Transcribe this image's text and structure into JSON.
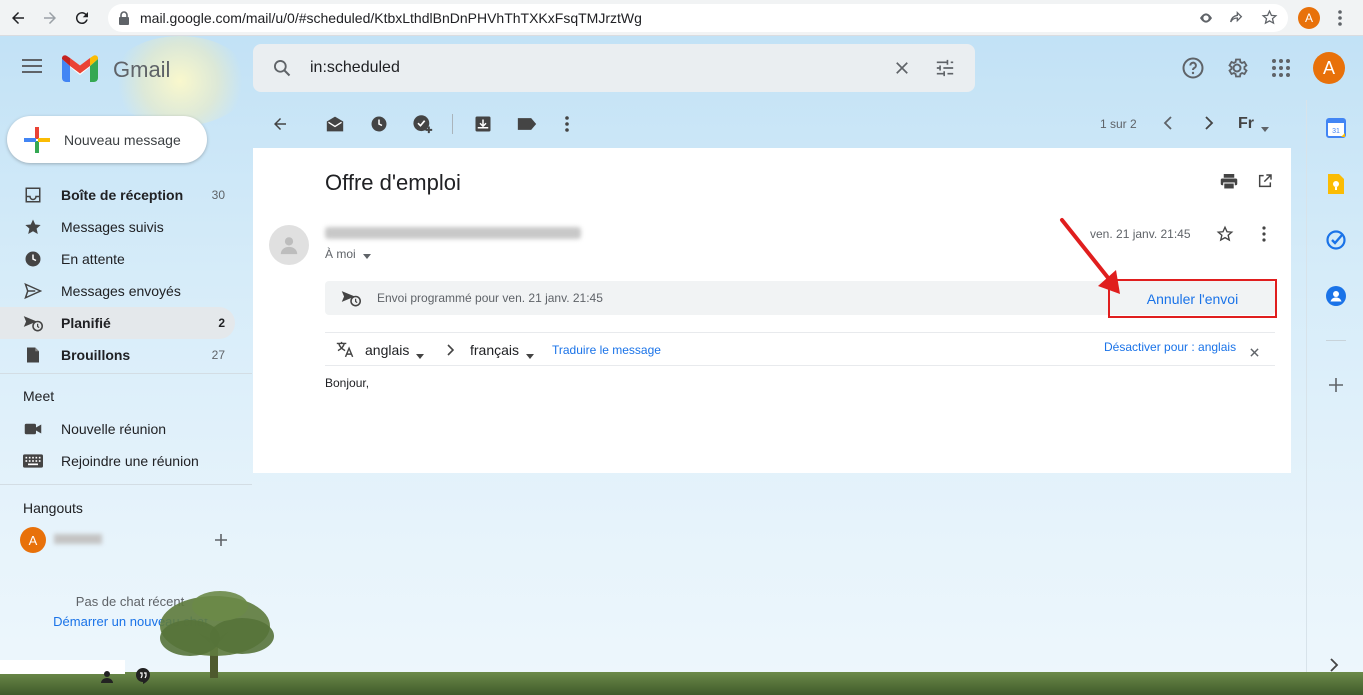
{
  "browser": {
    "url": "mail.google.com/mail/u/0/#scheduled/KtbxLthdlBnDnPHVhThTXKxFsqTMJrztWg",
    "profile_initial": "A"
  },
  "header": {
    "app_name": "Gmail",
    "search_query": "in:scheduled",
    "account_initial": "A"
  },
  "compose": {
    "label": "Nouveau message"
  },
  "sidebar": {
    "items": [
      {
        "label": "Boîte de réception",
        "count": "30",
        "icon": "inbox-icon",
        "bold": true
      },
      {
        "label": "Messages suivis",
        "count": "",
        "icon": "star-icon"
      },
      {
        "label": "En attente",
        "count": "",
        "icon": "clock-icon"
      },
      {
        "label": "Messages envoyés",
        "count": "",
        "icon": "send-icon"
      },
      {
        "label": "Planifié",
        "count": "2",
        "icon": "scheduled-send-icon",
        "bold": true,
        "active": true
      },
      {
        "label": "Brouillons",
        "count": "27",
        "icon": "draft-icon",
        "bold": true
      }
    ],
    "meet": {
      "title": "Meet",
      "new_meeting": "Nouvelle réunion",
      "join_meeting": "Rejoindre une réunion"
    },
    "hangouts": {
      "title": "Hangouts",
      "user_initial": "A",
      "no_chats": "Pas de chat récent",
      "start_chat": "Démarrer un nouveau chat"
    }
  },
  "toolbar": {
    "pagination": "1 sur 2",
    "lang_label": "Fr"
  },
  "message": {
    "subject": "Offre d'emploi",
    "to": "À moi",
    "date": "ven. 21 janv. 21:45",
    "scheduled_text": "Envoi programmé pour ven. 21 janv. 21:45",
    "cancel_label": "Annuler l'envoi",
    "translate": {
      "from_lang": "anglais",
      "to_lang": "français",
      "translate_link": "Traduire le message",
      "disable_link": "Désactiver pour : anglais"
    },
    "body": "Bonjour,"
  },
  "colors": {
    "accent": "#1a73e8",
    "highlight_box": "#e01e1e",
    "avatar": "#e8710a"
  }
}
